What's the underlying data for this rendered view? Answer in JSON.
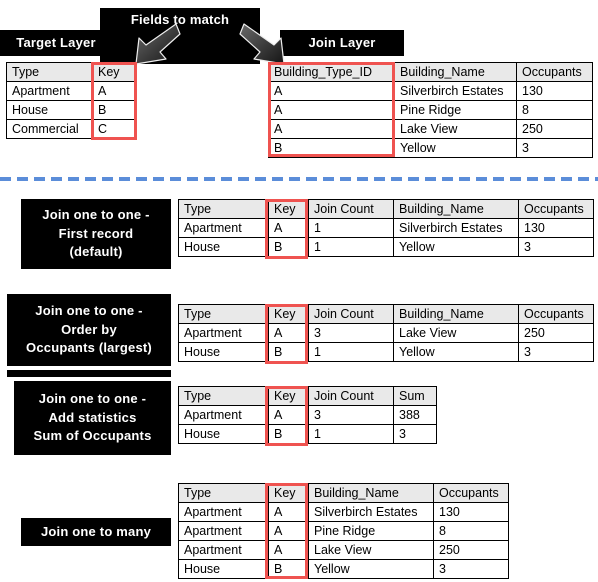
{
  "diagram": {
    "title_fields_to_match": "Fields to match",
    "target_layer_label": "Target Layer",
    "join_layer_label": "Join Layer",
    "arrow_left_name": "arrow-to-target-key",
    "arrow_right_name": "arrow-to-join-key"
  },
  "target_table": {
    "headers": [
      "Type",
      "Key"
    ],
    "rows": [
      [
        "Apartment",
        "A"
      ],
      [
        "House",
        "B"
      ],
      [
        "Commercial",
        "C"
      ]
    ]
  },
  "join_table": {
    "headers": [
      "Building_Type_ID",
      "Building_Name",
      "Occupants"
    ],
    "rows": [
      [
        "A",
        "Silverbirch Estates",
        "130"
      ],
      [
        "A",
        "Pine Ridge",
        "8"
      ],
      [
        "A",
        "Lake View",
        "250"
      ],
      [
        "B",
        "Yellow",
        "3"
      ]
    ]
  },
  "results": [
    {
      "label_lines": [
        "Join one to one -",
        "First record",
        "(default)"
      ],
      "headers": [
        "Type",
        "Key",
        "Join Count",
        "Building_Name",
        "Occupants"
      ],
      "rows": [
        [
          "Apartment",
          "A",
          "1",
          "Silverbirch Estates",
          "130"
        ],
        [
          "House",
          "B",
          "1",
          "Yellow",
          "3"
        ]
      ]
    },
    {
      "label_lines": [
        "Join one to one -",
        "Order by",
        "Occupants (largest)"
      ],
      "headers": [
        "Type",
        "Key",
        "Join Count",
        "Building_Name",
        "Occupants"
      ],
      "rows": [
        [
          "Apartment",
          "A",
          "3",
          "Lake View",
          "250"
        ],
        [
          "House",
          "B",
          "1",
          "Yellow",
          "3"
        ]
      ]
    },
    {
      "label_lines": [
        "Join one to one -",
        "Add statistics",
        "Sum of Occupants"
      ],
      "headers": [
        "Type",
        "Key",
        "Join Count",
        "Sum"
      ],
      "rows": [
        [
          "Apartment",
          "A",
          "3",
          "388"
        ],
        [
          "House",
          "B",
          "1",
          "3"
        ]
      ]
    },
    {
      "label_lines": [
        "Join one to many"
      ],
      "headers": [
        "Type",
        "Key",
        "Building_Name",
        "Occupants"
      ],
      "rows": [
        [
          "Apartment",
          "A",
          "Silverbirch Estates",
          "130"
        ],
        [
          "Apartment",
          "A",
          "Pine Ridge",
          "8"
        ],
        [
          "Apartment",
          "A",
          "Lake View",
          "250"
        ],
        [
          "House",
          "B",
          "Yellow",
          "3"
        ]
      ]
    }
  ],
  "colors": {
    "highlight_red": "#ef5350",
    "divider_blue": "#5b8dd9",
    "header_gray": "#e9e9e9",
    "label_background": "#000000"
  }
}
